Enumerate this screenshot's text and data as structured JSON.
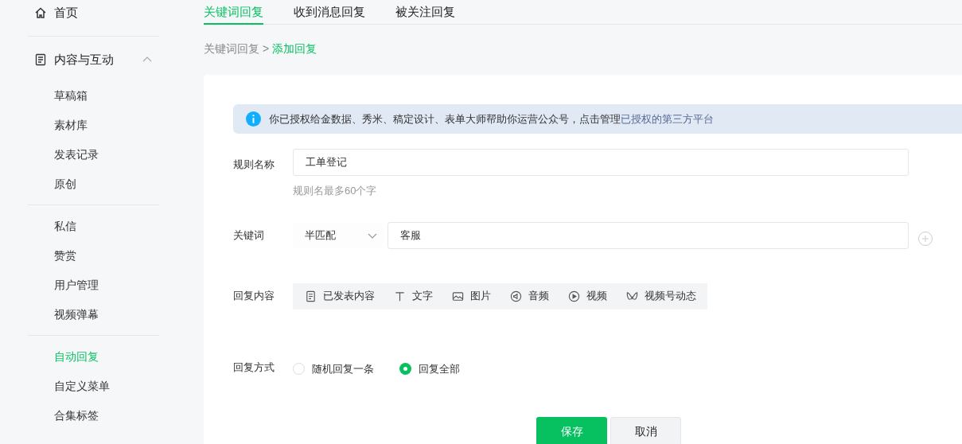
{
  "sidebar": {
    "home": {
      "label": "首页"
    },
    "section": {
      "label": "内容与互动",
      "expanded": true,
      "groups": [
        [
          {
            "label": "草稿箱",
            "selected": false
          },
          {
            "label": "素材库",
            "selected": false
          },
          {
            "label": "发表记录",
            "selected": false
          },
          {
            "label": "原创",
            "selected": false
          }
        ],
        [
          {
            "label": "私信",
            "selected": false
          },
          {
            "label": "赞赏",
            "selected": false
          },
          {
            "label": "用户管理",
            "selected": false
          },
          {
            "label": "视频弹幕",
            "selected": false
          }
        ],
        [
          {
            "label": "自动回复",
            "selected": true
          },
          {
            "label": "自定义菜单",
            "selected": false
          },
          {
            "label": "合集标签",
            "selected": false
          }
        ]
      ]
    }
  },
  "tabs": [
    {
      "label": "关键词回复",
      "selected": true
    },
    {
      "label": "收到消息回复",
      "selected": false
    },
    {
      "label": "被关注回复",
      "selected": false
    }
  ],
  "breadcrumb": {
    "parent": "关键词回复",
    "separator": ">",
    "current": "添加回复"
  },
  "notice": {
    "text": "你已授权给金数据、秀米、稿定设计、表单大师帮助你运营公众号，点击管理",
    "link": "已授权的第三方平台"
  },
  "form": {
    "rule_name": {
      "label": "规则名称",
      "value": "工单登记",
      "hint": "规则名最多60个字"
    },
    "keyword": {
      "label": "关键词",
      "match": "半匹配",
      "value": "客服"
    },
    "reply_content": {
      "label": "回复内容",
      "types": [
        {
          "kind": "published",
          "label": "已发表内容"
        },
        {
          "kind": "text",
          "label": "文字"
        },
        {
          "kind": "image",
          "label": "图片"
        },
        {
          "kind": "audio",
          "label": "音频"
        },
        {
          "kind": "video",
          "label": "视频"
        },
        {
          "kind": "channels",
          "label": "视频号动态"
        }
      ]
    },
    "reply_mode": {
      "label": "回复方式",
      "options": [
        {
          "label": "随机回复一条",
          "selected": false
        },
        {
          "label": "回复全部",
          "selected": true
        }
      ]
    }
  },
  "buttons": [
    {
      "kind": "primary",
      "label": "保存"
    },
    {
      "kind": "secondary",
      "label": "取消"
    }
  ]
}
